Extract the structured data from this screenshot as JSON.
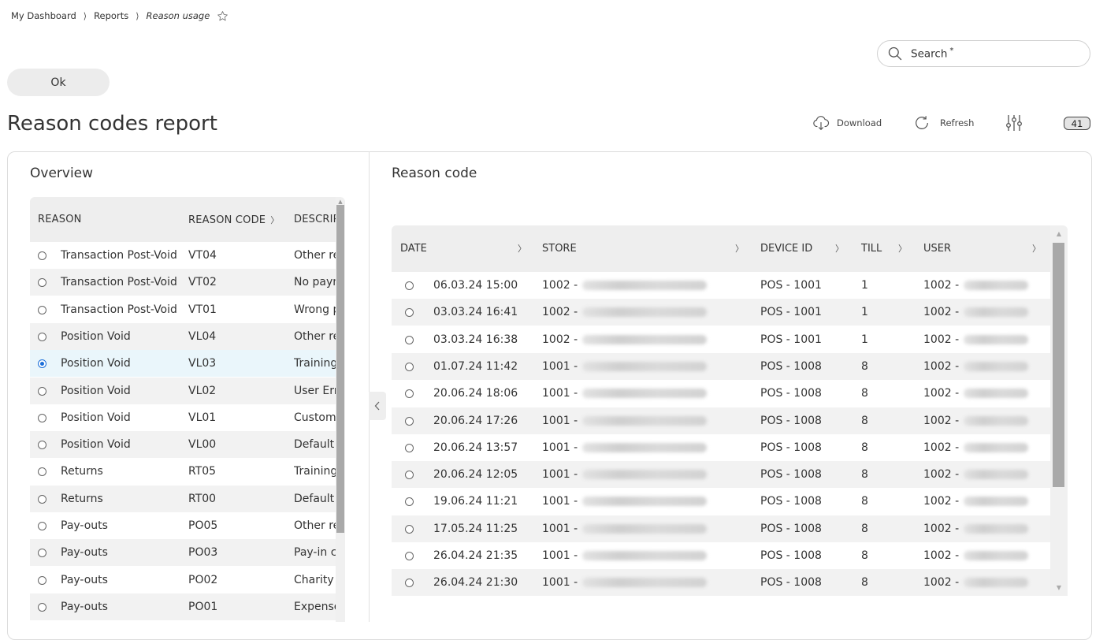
{
  "breadcrumb": {
    "items": [
      "My Dashboard",
      "Reports"
    ],
    "separator": "⟩",
    "current": "Reason usage",
    "favorite_icon": "star-outline-icon"
  },
  "search": {
    "label": "Search",
    "required_mark": "*",
    "icon": "search-icon"
  },
  "ok_button": {
    "label": "Ok"
  },
  "page_title": "Reason codes report",
  "toolbar": {
    "download": {
      "label": "Download",
      "icon": "cloud-download-icon"
    },
    "refresh": {
      "label": "Refresh",
      "icon": "refresh-icon"
    },
    "settings": {
      "icon": "sliders-icon"
    },
    "count": "41"
  },
  "overview": {
    "title": "Overview",
    "columns": [
      "REASON",
      "REASON CODE",
      "DESCRIPTION"
    ],
    "rows": [
      {
        "reason": "Transaction Post-Void",
        "code": "VT04",
        "description": "Other reason",
        "selected": false
      },
      {
        "reason": "Transaction Post-Void",
        "code": "VT02",
        "description": "No payment",
        "selected": false
      },
      {
        "reason": "Transaction Post-Void",
        "code": "VT01",
        "description": "Wrong payment",
        "selected": false
      },
      {
        "reason": "Position Void",
        "code": "VL04",
        "description": "Other reason",
        "selected": false
      },
      {
        "reason": "Position Void",
        "code": "VL03",
        "description": "Training",
        "selected": true
      },
      {
        "reason": "Position Void",
        "code": "VL02",
        "description": "User Error",
        "selected": false
      },
      {
        "reason": "Position Void",
        "code": "VL01",
        "description": "Customer",
        "selected": false
      },
      {
        "reason": "Position Void",
        "code": "VL00",
        "description": "Default",
        "selected": false
      },
      {
        "reason": "Returns",
        "code": "RT05",
        "description": "Training",
        "selected": false
      },
      {
        "reason": "Returns",
        "code": "RT00",
        "description": "Default",
        "selected": false
      },
      {
        "reason": "Pay-outs",
        "code": "PO05",
        "description": "Other reason",
        "selected": false
      },
      {
        "reason": "Pay-outs",
        "code": "PO03",
        "description": "Pay-in correction",
        "selected": false
      },
      {
        "reason": "Pay-outs",
        "code": "PO02",
        "description": "Charity",
        "selected": false
      },
      {
        "reason": "Pay-outs",
        "code": "PO01",
        "description": "Expenses",
        "selected": false
      }
    ]
  },
  "reason_code": {
    "title": "Reason code",
    "columns": [
      "DATE",
      "STORE",
      "DEVICE ID",
      "TILL",
      "USER"
    ],
    "rows": [
      {
        "date": "06.03.24 15:00",
        "store": "1002 -",
        "device": "POS - 1001",
        "till": "1",
        "user": "1002 -"
      },
      {
        "date": "03.03.24 16:41",
        "store": "1002 -",
        "device": "POS - 1001",
        "till": "1",
        "user": "1002 -"
      },
      {
        "date": "03.03.24 16:38",
        "store": "1002 -",
        "device": "POS - 1001",
        "till": "1",
        "user": "1002 -"
      },
      {
        "date": "01.07.24 11:42",
        "store": "1001 -",
        "device": "POS - 1008",
        "till": "8",
        "user": "1002 -"
      },
      {
        "date": "20.06.24 18:06",
        "store": "1001 -",
        "device": "POS - 1008",
        "till": "8",
        "user": "1002 -"
      },
      {
        "date": "20.06.24 17:26",
        "store": "1001 -",
        "device": "POS - 1008",
        "till": "8",
        "user": "1002 -"
      },
      {
        "date": "20.06.24 13:57",
        "store": "1001 -",
        "device": "POS - 1008",
        "till": "8",
        "user": "1002 -"
      },
      {
        "date": "20.06.24 12:05",
        "store": "1001 -",
        "device": "POS - 1008",
        "till": "8",
        "user": "1002 -"
      },
      {
        "date": "19.06.24 11:21",
        "store": "1001 -",
        "device": "POS - 1008",
        "till": "8",
        "user": "1002 -"
      },
      {
        "date": "17.05.24 11:25",
        "store": "1001 -",
        "device": "POS - 1008",
        "till": "8",
        "user": "1002 -"
      },
      {
        "date": "26.04.24 21:35",
        "store": "1001 -",
        "device": "POS - 1008",
        "till": "8",
        "user": "1002 -"
      },
      {
        "date": "26.04.24 21:30",
        "store": "1001 -",
        "device": "POS - 1008",
        "till": "8",
        "user": "1002 -"
      }
    ]
  },
  "colors": {
    "header_bg": "#eeeeee",
    "stripe_bg": "#f2f2f2",
    "selected_row_bg": "#eaf6fb",
    "radio_selected": "#1a6ed8",
    "scroll_thumb": "#a9a9a9"
  }
}
